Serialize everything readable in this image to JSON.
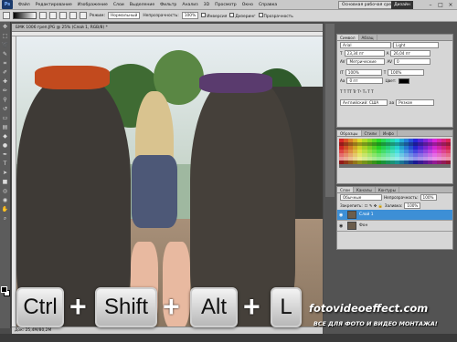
{
  "menubar": {
    "logo": "Ps",
    "items": [
      "Файл",
      "Редактирование",
      "Изображение",
      "Слои",
      "Выделение",
      "Фильтр",
      "Анализ",
      "3D",
      "Просмотр",
      "Окно",
      "Справка"
    ],
    "workspace": "Основная рабочая среда",
    "design": "Дизайн",
    "minimize": "–",
    "maximize": "□",
    "close": "×"
  },
  "options": {
    "mode_label": "Режим:",
    "mode_value": "Нормальный",
    "opacity_label": "Непрозрачность:",
    "opacity_value": "100%",
    "invert_label": "Инверсия",
    "dither_label": "Дизеринг",
    "transparency_label": "Прозрачность"
  },
  "document": {
    "tab_title": "БМК 1006 греп.JPG @ 25% (Слой 1, RGB/8) *",
    "status": "Док: 25,4M/80,2M"
  },
  "character_panel": {
    "tabs": [
      "Символ",
      "Абзац"
    ],
    "font": "Arial",
    "style": "Light",
    "size": "23,34 пт",
    "leading": "26,04 пт",
    "kerning": "Метрические",
    "tracking": "0",
    "vscale": "100%",
    "hscale": "100%",
    "baseline": "0 пт",
    "color_label": "Цвет:",
    "language": "Английский: США",
    "aa": "Резкое"
  },
  "swatches_panel": {
    "tabs": [
      "Образцы",
      "Стили",
      "Инфо"
    ]
  },
  "layers_panel": {
    "tabs": [
      "Слои",
      "Каналы",
      "Контуры"
    ],
    "blend_mode": "Обычные",
    "opacity_label": "Непрозрачность:",
    "opacity_value": "100%",
    "lock_label": "Закрепить:",
    "fill_label": "Заливка:",
    "fill_value": "100%",
    "layers": [
      {
        "name": "Слой 1",
        "selected": true
      },
      {
        "name": "Фон",
        "selected": false
      }
    ]
  },
  "overlay": {
    "keys": [
      "Ctrl",
      "Shift",
      "Alt",
      "L"
    ],
    "plus": "+",
    "watermark": "fotovideoeffect.com",
    "slogan": "ВСЕ ДЛЯ ФОТО И ВИДЕО МОНТАЖА!"
  }
}
